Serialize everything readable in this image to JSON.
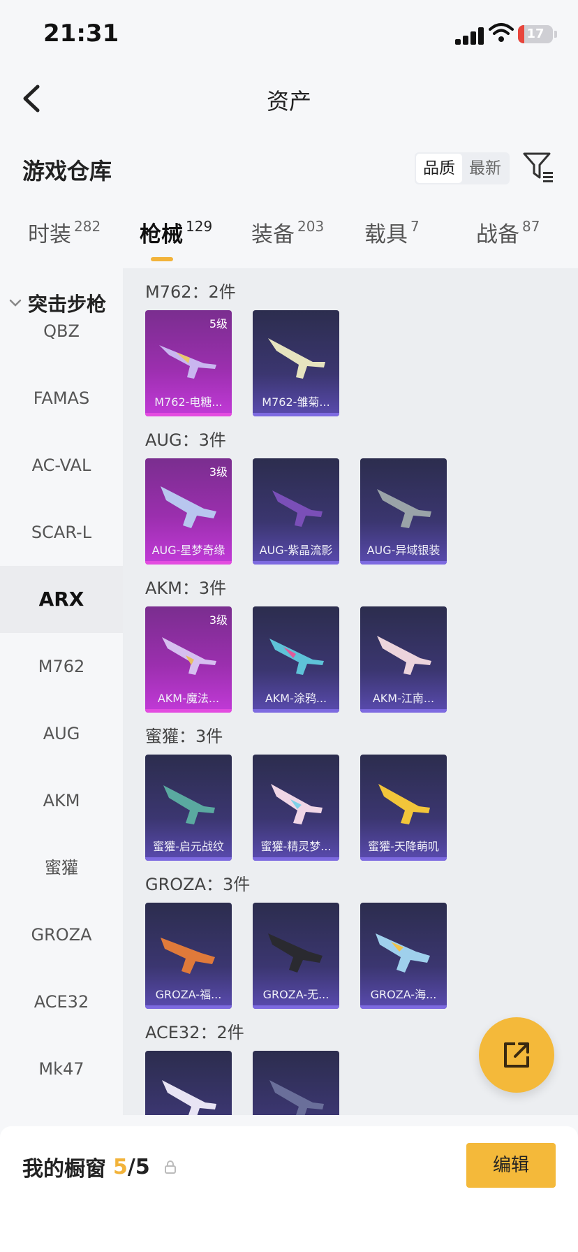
{
  "status_bar": {
    "time": "21:31",
    "battery": "17"
  },
  "nav": {
    "title": "资产"
  },
  "warehouse": {
    "title": "游戏仓库",
    "sort_options": [
      "品质",
      "最新"
    ]
  },
  "tabs": [
    {
      "label": "时装",
      "count": "282"
    },
    {
      "label": "枪械",
      "count": "129"
    },
    {
      "label": "装备",
      "count": "203"
    },
    {
      "label": "载具",
      "count": "7"
    },
    {
      "label": "战备",
      "count": "87"
    }
  ],
  "sidebar": {
    "category": "突击步枪",
    "items": [
      "QBZ",
      "FAMAS",
      "AC-VAL",
      "SCAR-L",
      "ARX",
      "M762",
      "AUG",
      "AKM",
      "蜜獾",
      "GROZA",
      "ACE32",
      "Mk47"
    ],
    "selected": "ARX"
  },
  "groups": [
    {
      "title": "M762：2件",
      "cards": [
        {
          "name": "M762-电糖...",
          "level": "5级"
        },
        {
          "name": "M762-雏菊...",
          "level": ""
        }
      ]
    },
    {
      "title": "AUG：3件",
      "cards": [
        {
          "name": "AUG-星梦奇缘",
          "level": "3级"
        },
        {
          "name": "AUG-紫晶流影",
          "level": ""
        },
        {
          "name": "AUG-异域银装",
          "level": ""
        }
      ]
    },
    {
      "title": "AKM：3件",
      "cards": [
        {
          "name": "AKM-魔法...",
          "level": "3级"
        },
        {
          "name": "AKM-涂鸦...",
          "level": ""
        },
        {
          "name": "AKM-江南...",
          "level": ""
        }
      ]
    },
    {
      "title": "蜜獾：3件",
      "cards": [
        {
          "name": "蜜獾-启元战纹",
          "level": ""
        },
        {
          "name": "蜜獾-精灵梦...",
          "level": ""
        },
        {
          "name": "蜜獾-天降萌叽",
          "level": ""
        }
      ]
    },
    {
      "title": "GROZA：3件",
      "cards": [
        {
          "name": "GROZA-福...",
          "level": ""
        },
        {
          "name": "GROZA-无...",
          "level": ""
        },
        {
          "name": "GROZA-海...",
          "level": ""
        }
      ]
    },
    {
      "title": "ACE32：2件",
      "cards": [
        {
          "name": "",
          "level": ""
        },
        {
          "name": "",
          "level": ""
        }
      ]
    }
  ],
  "showcase": {
    "label": "我的橱窗",
    "current": "5",
    "separator": "/",
    "total": "5",
    "edit_label": "编辑"
  },
  "colors": {
    "accent": "#f4b93a",
    "legendary_card": "#b530c8",
    "epic_card": "#3b3670"
  }
}
